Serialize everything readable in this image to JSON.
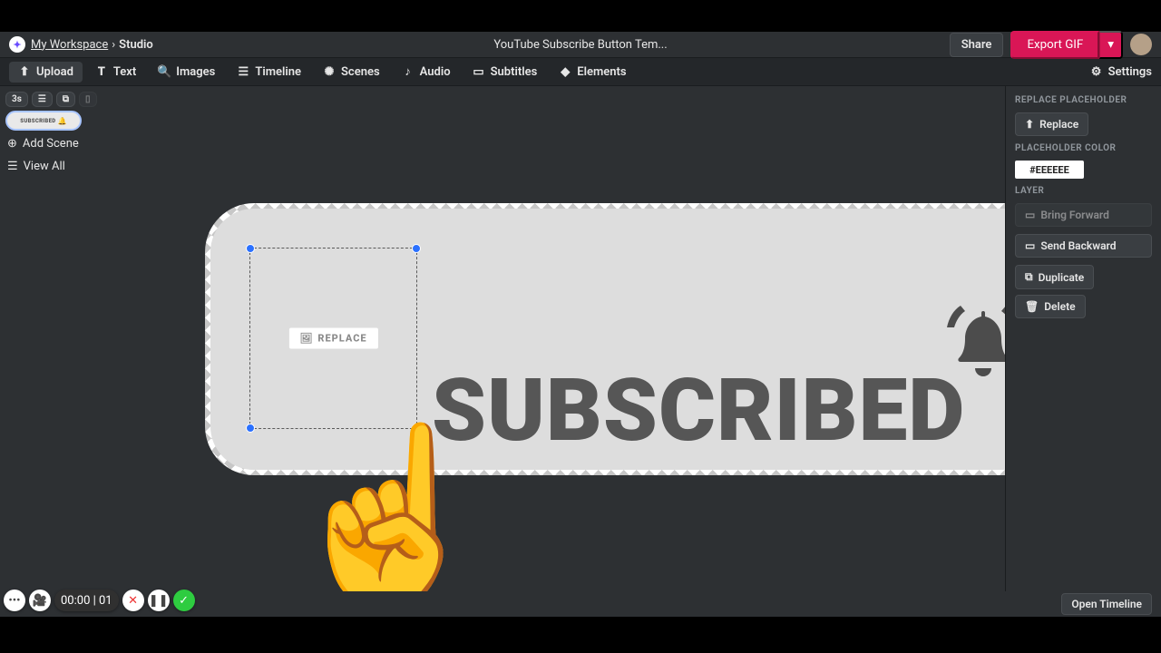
{
  "header": {
    "workspace_link": "My Workspace",
    "studio_label": "Studio",
    "doc_title": "YouTube Subscribe Button Tem...",
    "share": "Share",
    "export": "Export GIF"
  },
  "toolbar": {
    "upload": "Upload",
    "text": "Text",
    "images": "Images",
    "timeline": "Timeline",
    "scenes": "Scenes",
    "audio": "Audio",
    "subtitles": "Subtitles",
    "elements": "Elements",
    "settings": "Settings"
  },
  "left": {
    "duration": "3s",
    "thumb_text": "SUBSCRIBED",
    "add_scene": "Add Scene",
    "view_all": "View All"
  },
  "canvas": {
    "big_text": "SUBSCRIBED",
    "replace_chip": "REPLACE"
  },
  "right": {
    "replace_section": "REPLACE PLACEHOLDER",
    "replace_btn": "Replace",
    "color_section": "PLACEHOLDER COLOR",
    "color_value": "#EEEEEE",
    "layer_section": "LAYER",
    "bring_forward": "Bring Forward",
    "send_backward": "Send Backward",
    "duplicate": "Duplicate",
    "delete": "Delete"
  },
  "bottom": {
    "open_timeline": "Open Timeline"
  },
  "rec": {
    "menu": "•••",
    "time": "00:00 | 01",
    "close": "✕",
    "pause": "❚❚",
    "ok": "✓"
  }
}
